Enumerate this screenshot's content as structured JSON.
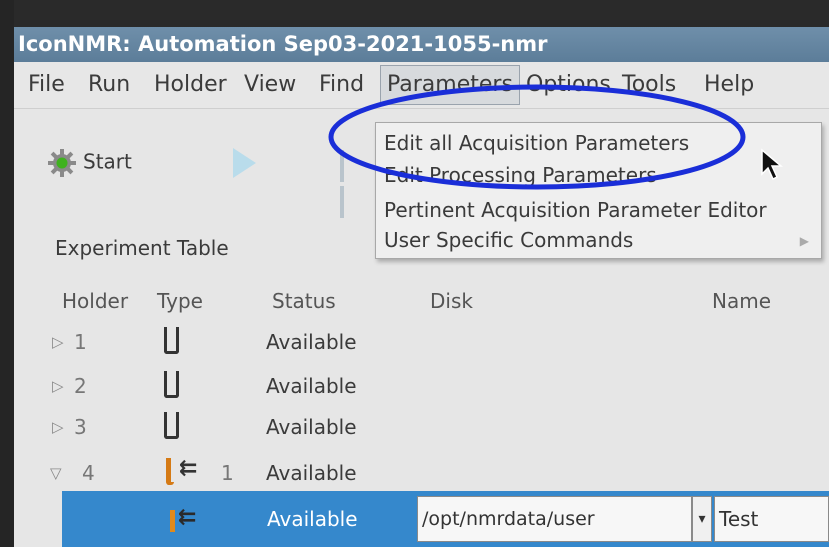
{
  "window": {
    "title": "IconNMR: Automation Sep03-2021-1055-nmr"
  },
  "menubar": {
    "items": [
      "File",
      "Run",
      "Holder",
      "View",
      "Find",
      "Parameters",
      "Options",
      "Tools",
      "Help"
    ]
  },
  "parameters_menu": {
    "items": [
      "Edit all Acquisition Parameters",
      "Edit Processing Parameters",
      "Pertinent Acquisition Parameter Editor",
      "User Specific Commands"
    ]
  },
  "toolbar": {
    "start_label": "Start"
  },
  "experiment_table": {
    "label": "Experiment Table",
    "headers": [
      "Holder",
      "Type",
      "Status",
      "Disk",
      "Name"
    ],
    "rows": [
      {
        "holder": "1",
        "status": "Available"
      },
      {
        "holder": "2",
        "status": "Available"
      },
      {
        "holder": "3",
        "status": "Available"
      },
      {
        "holder": "4",
        "count": "1",
        "status": "Available"
      }
    ],
    "selected": {
      "status": "Available",
      "disk": "/opt/nmrdata/user",
      "name": "Test"
    }
  },
  "colors": {
    "title_bar": "#5c7d99",
    "selection": "#3588cc",
    "annotation": "#1a2ed8"
  }
}
